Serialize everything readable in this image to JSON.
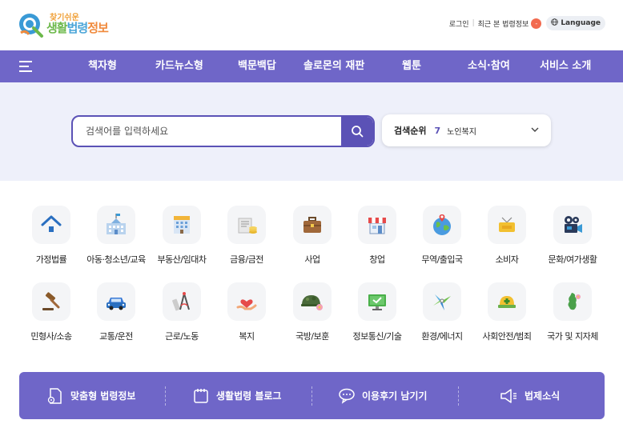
{
  "header": {
    "logo": {
      "small": "찾기쉬운",
      "big_1": "생활",
      "big_2": "법령",
      "big_3": "정보"
    },
    "utility": {
      "login": "로그인",
      "recent": "최근 본 법령정보",
      "recent_count": "-",
      "language": "Language"
    }
  },
  "nav": {
    "items": [
      "책자형",
      "카드뉴스형",
      "백문백답",
      "솔로몬의 재판",
      "웹툰",
      "소식·참여",
      "서비스 소개"
    ]
  },
  "search": {
    "placeholder": "검색어를 입력하세요",
    "rank_title": "검색순위",
    "rank_num": "7",
    "rank_term": "노인복지"
  },
  "categories": [
    {
      "label": "가정법률",
      "icon": "house-icon"
    },
    {
      "label": "아동·청소년/교육",
      "icon": "school-icon"
    },
    {
      "label": "부동산/임대차",
      "icon": "building-icon"
    },
    {
      "label": "금융/금전",
      "icon": "money-icon"
    },
    {
      "label": "사업",
      "icon": "briefcase-icon"
    },
    {
      "label": "창업",
      "icon": "store-icon"
    },
    {
      "label": "무역/출입국",
      "icon": "globe-icon"
    },
    {
      "label": "소비자",
      "icon": "sale-sign-icon"
    },
    {
      "label": "문화/여가생활",
      "icon": "camera-icon"
    },
    {
      "label": "민형사/소송",
      "icon": "gavel-icon"
    },
    {
      "label": "교통/운전",
      "icon": "car-icon"
    },
    {
      "label": "근로/노동",
      "icon": "tools-icon"
    },
    {
      "label": "복지",
      "icon": "heart-hand-icon"
    },
    {
      "label": "국방/보훈",
      "icon": "helmet-icon"
    },
    {
      "label": "정보통신/기술",
      "icon": "monitor-icon"
    },
    {
      "label": "환경/에너지",
      "icon": "windmill-icon"
    },
    {
      "label": "사회안전/범죄",
      "icon": "safety-helmet-icon"
    },
    {
      "label": "국가 및 지자체",
      "icon": "korea-map-icon"
    }
  ],
  "bottom": {
    "items": [
      "맞춤형 법령정보",
      "생활법령 블로그",
      "이용후기 남기기",
      "법제소식"
    ]
  },
  "colors": {
    "primary": "#6f66c8",
    "search_border": "#5b52b6",
    "band": "#eef0fa"
  }
}
